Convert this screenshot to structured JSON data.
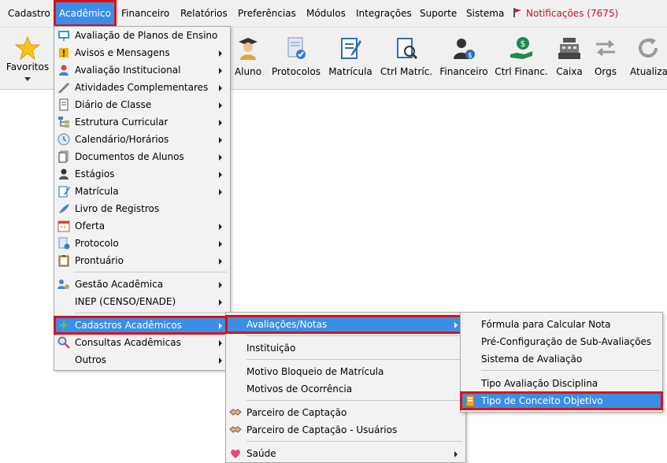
{
  "menubar": {
    "items": [
      "Cadastro",
      "Acadêmico",
      "Financeiro",
      "Relatórios",
      "Preferências",
      "Módulos",
      "Integrações",
      "Suporte",
      "Sistema"
    ],
    "notifications": "Notificações (7675)"
  },
  "toolbar": {
    "favoritos": "Favoritos",
    "buttons": [
      "Aluno",
      "Protocolos",
      "Matrícula",
      "Ctrl Matríc.",
      "Financeiro",
      "Ctrl Financ.",
      "Caixa",
      "Orgs",
      "Atualizar"
    ]
  },
  "academico_menu": {
    "items": [
      "Avaliação de Planos de Ensino",
      "Avisos e Mensagens",
      "Avaliação Institucional",
      "Atividades Complementares",
      "Diário de Classe",
      "Estrutura Curricular",
      "Calendário/Horários",
      "Documentos de Alunos",
      "Estágios",
      "Matrícula",
      "Livro de Registros",
      "Oferta",
      "Protocolo",
      "Prontuário",
      "Gestão Acadêmica",
      "INEP (CENSO/ENADE)",
      "Cadastros Acadêmicos",
      "Consultas Acadêmicas",
      "Outros"
    ]
  },
  "cadastros_menu": {
    "items": [
      "Avaliações/Notas",
      "Instituição",
      "Motivo Bloqueio de Matrícula",
      "Motivos de Ocorrência",
      "Parceiro de Captação",
      "Parceiro de Captação - Usuários",
      "Saúde"
    ]
  },
  "avaliacoes_menu": {
    "items": [
      "Fórmula para Calcular Nota",
      "Pré-Configuração de Sub-Avaliações",
      "Sistema de Avaliação",
      "Tipo Avaliação Disciplina",
      "Tipo de Conceito Objetivo"
    ]
  },
  "colors": {
    "highlight": "#3a8ee6",
    "annotation_border": "#e01010",
    "notification": "#c8102e"
  }
}
